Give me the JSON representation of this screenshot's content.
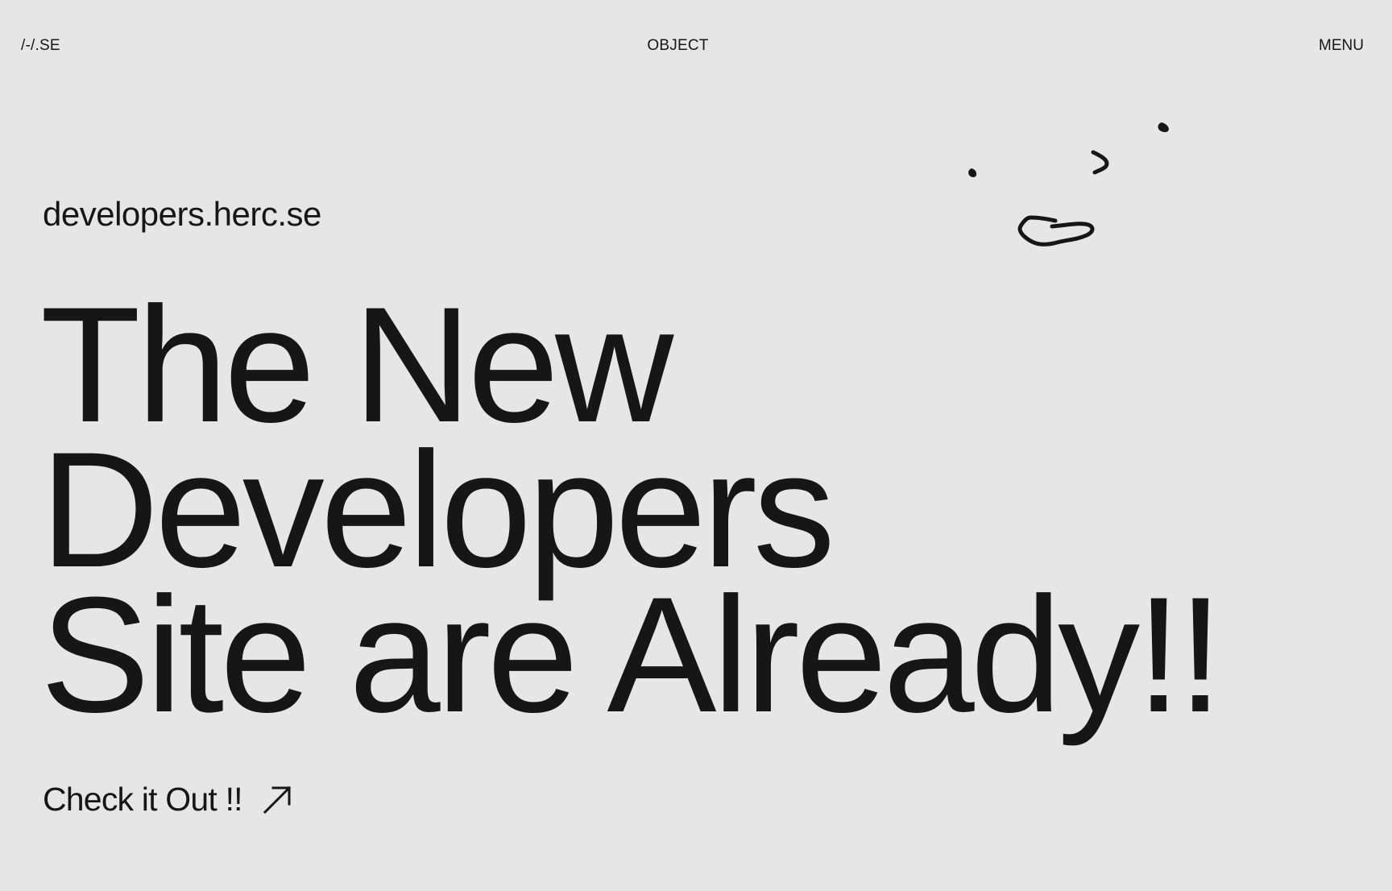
{
  "header": {
    "brand": "/-/.SE",
    "center_link": "OBJECT",
    "menu_label": "MENU"
  },
  "hero": {
    "site_url": "developers.herc.se",
    "title_lines": [
      "The New",
      "Developers",
      "Site are Already!!"
    ],
    "cta_label": "Check it Out !!",
    "cta_icon": "arrow-up-right-icon"
  },
  "decoration": {
    "doodle": "face-doodle-icon"
  },
  "colors": {
    "background": "#e6e6e6",
    "text": "#161616"
  }
}
